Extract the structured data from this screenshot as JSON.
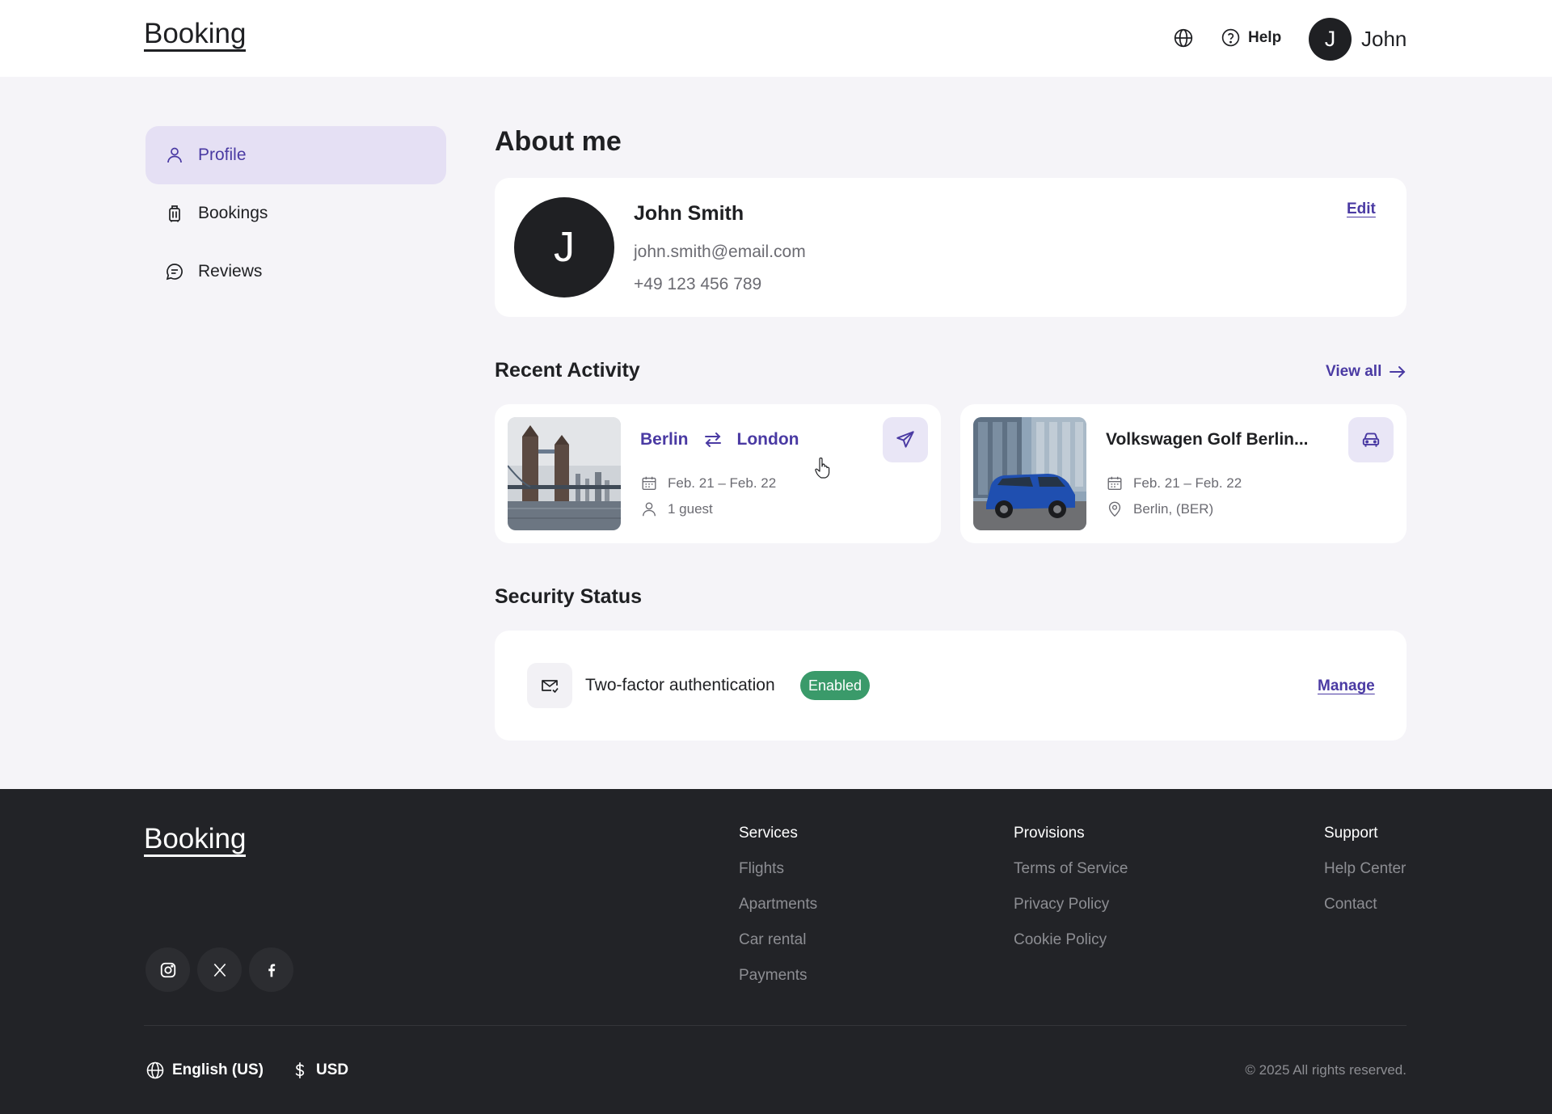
{
  "header": {
    "logo": "Booking",
    "help_label": "Help",
    "user_initial": "J",
    "user_name": "John"
  },
  "sidebar": {
    "items": [
      {
        "label": "Profile",
        "icon": "user-icon",
        "active": true
      },
      {
        "label": "Bookings",
        "icon": "luggage-icon",
        "active": false
      },
      {
        "label": "Reviews",
        "icon": "chat-icon",
        "active": false
      }
    ]
  },
  "about": {
    "title": "About me",
    "initial": "J",
    "name": "John Smith",
    "email": "john.smith@email.com",
    "phone": "+49 123 456 789",
    "edit_label": "Edit"
  },
  "activity": {
    "title": "Recent Activity",
    "view_all": "View all",
    "flight": {
      "from": "Berlin",
      "to": "London",
      "dates": "Feb. 21 – Feb. 22",
      "guests": "1 guest",
      "icon": "plane-icon"
    },
    "car": {
      "title": "Volkswagen Golf Berlin...",
      "dates": "Feb. 21 – Feb. 22",
      "location": "Berlin, (BER)",
      "icon": "car-icon"
    }
  },
  "security": {
    "title": "Security Status",
    "item_label": "Two-factor authentication",
    "status": "Enabled",
    "manage_label": "Manage"
  },
  "footer": {
    "logo": "Booking",
    "columns": [
      {
        "title": "Services",
        "links": [
          "Flights",
          "Apartments",
          "Car rental",
          "Payments"
        ]
      },
      {
        "title": "Provisions",
        "links": [
          "Terms of Service",
          "Privacy Policy",
          "Cookie Policy"
        ]
      },
      {
        "title": "Support",
        "links": [
          "Help Center",
          "Contact"
        ]
      }
    ],
    "language": "English (US)",
    "currency": "USD",
    "copyright": "© 2025 All rights reserved."
  },
  "colors": {
    "accent": "#4a3aa3",
    "accent_soft": "#e5e0f4",
    "success": "#3a9a6a",
    "footer_bg": "#222327"
  }
}
